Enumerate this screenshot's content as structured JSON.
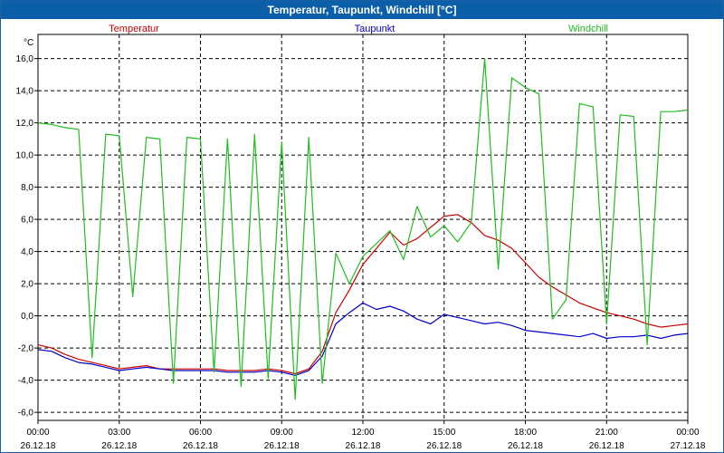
{
  "window": {
    "title": "Temperatur, Taupunkt, Windchill [°C]"
  },
  "chart_data": {
    "type": "line",
    "title": "Temperatur, Taupunkt, Windchill [°C]",
    "ylabel": "°C",
    "ylim": [
      -6.5,
      17.5
    ],
    "y_ticks": [
      "16,0",
      "14,0",
      "12,0",
      "10,0",
      "8,0",
      "6,0",
      "4,0",
      "2,0",
      "0,0",
      "-2,0",
      "-4,0",
      "-6,0"
    ],
    "x_ticks": [
      {
        "time": "00:00",
        "date": "26.12.18"
      },
      {
        "time": "03:00",
        "date": "26.12.18"
      },
      {
        "time": "06:00",
        "date": "26.12.18"
      },
      {
        "time": "09:00",
        "date": "26.12.18"
      },
      {
        "time": "12:00",
        "date": "26.12.18"
      },
      {
        "time": "15:00",
        "date": "26.12.18"
      },
      {
        "time": "18:00",
        "date": "26.12.18"
      },
      {
        "time": "21:00",
        "date": "26.12.18"
      },
      {
        "time": "00:00",
        "date": "27.12.18"
      }
    ],
    "grid": true,
    "legend_position": "top",
    "x": [
      0,
      0.5,
      1,
      1.5,
      2,
      2.5,
      3,
      3.5,
      4,
      4.5,
      5,
      5.5,
      6,
      6.5,
      7,
      7.5,
      8,
      8.5,
      9,
      9.5,
      10,
      10.5,
      11,
      11.5,
      12,
      12.5,
      13,
      13.5,
      14,
      14.5,
      15,
      15.5,
      16,
      16.5,
      17,
      17.5,
      18,
      18.5,
      19,
      19.5,
      20,
      20.5,
      21,
      21.5,
      22,
      22.5,
      23,
      23.5,
      24
    ],
    "series": [
      {
        "name": "Temperatur",
        "color": "#cc0000",
        "values": [
          -1.8,
          -2.0,
          -2.4,
          -2.7,
          -2.9,
          -3.1,
          -3.3,
          -3.2,
          -3.1,
          -3.3,
          -3.3,
          -3.3,
          -3.3,
          -3.3,
          -3.4,
          -3.4,
          -3.4,
          -3.3,
          -3.4,
          -3.6,
          -3.3,
          -2.2,
          0.2,
          1.6,
          3.2,
          4.2,
          5.2,
          4.4,
          4.8,
          5.5,
          6.2,
          6.3,
          5.8,
          5.0,
          4.7,
          4.2,
          3.3,
          2.4,
          1.8,
          1.3,
          0.8,
          0.5,
          0.2,
          0.0,
          -0.2,
          -0.5,
          -0.7,
          -0.6,
          -0.5
        ]
      },
      {
        "name": "Taupunkt",
        "color": "#0000cc",
        "values": [
          -2.1,
          -2.2,
          -2.6,
          -2.9,
          -3.0,
          -3.2,
          -3.4,
          -3.3,
          -3.2,
          -3.3,
          -3.4,
          -3.4,
          -3.4,
          -3.4,
          -3.5,
          -3.5,
          -3.5,
          -3.4,
          -3.5,
          -3.7,
          -3.4,
          -2.5,
          -0.5,
          0.2,
          0.8,
          0.4,
          0.6,
          0.3,
          -0.2,
          -0.5,
          0.1,
          -0.1,
          -0.3,
          -0.5,
          -0.4,
          -0.6,
          -0.9,
          -1.0,
          -1.1,
          -1.2,
          -1.3,
          -1.1,
          -1.4,
          -1.3,
          -1.3,
          -1.2,
          -1.4,
          -1.2,
          -1.1
        ]
      },
      {
        "name": "Windchill",
        "color": "#22bb22",
        "values": [
          12.0,
          11.9,
          11.7,
          11.6,
          -2.6,
          11.3,
          11.2,
          1.2,
          11.1,
          11.0,
          -4.2,
          11.1,
          11.0,
          -3.5,
          11.0,
          -4.4,
          11.3,
          -3.9,
          10.8,
          -5.2,
          11.1,
          -4.2,
          3.9,
          2.0,
          3.7,
          4.5,
          5.3,
          3.5,
          6.8,
          4.9,
          5.6,
          4.6,
          5.8,
          16.0,
          2.9,
          14.8,
          14.2,
          13.8,
          -0.2,
          1.0,
          13.2,
          13.0,
          -0.5,
          12.5,
          12.4,
          -1.8,
          12.7,
          12.7,
          12.8
        ]
      }
    ]
  }
}
